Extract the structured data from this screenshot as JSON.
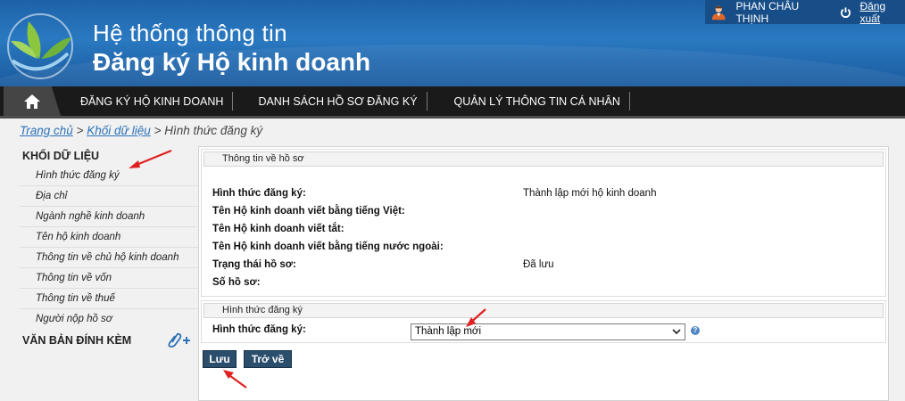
{
  "header": {
    "title_line1": "Hệ thống thông tin",
    "title_line2": "Đăng ký Hộ kinh doanh",
    "user_name": "PHAN CHÂU THỊNH",
    "logout_label": "Đăng xuất",
    "colors": {
      "banner": "#2a79c1",
      "nav": "#1a1a1a"
    }
  },
  "nav": {
    "home_icon": "home-icon",
    "items": [
      "ĐĂNG KÝ HỘ KINH DOANH",
      "DANH SÁCH HỒ SƠ ĐĂNG KÝ",
      "QUẢN LÝ THÔNG TIN CÁ NHÂN"
    ]
  },
  "breadcrumb": {
    "home": "Trang chủ",
    "separator": ">",
    "section": "Khối dữ liệu",
    "current": "Hình thức đăng ký"
  },
  "sidebar": {
    "heading": "KHỐI DỮ LIỆU",
    "items": [
      "Hình thức đăng ký",
      "Địa chỉ",
      "Ngành nghề kinh doanh",
      "Tên hộ kinh doanh",
      "Thông tin về chủ hộ kinh doanh",
      "Thông tin về vốn",
      "Thông tin về thuế",
      "Người nộp hồ sơ"
    ],
    "attachments_heading": "VĂN BẢN ĐÍNH KÈM"
  },
  "info": {
    "title": "Thông tin về hồ sơ",
    "rows": [
      {
        "label": "Hình thức đăng ký:",
        "value": "Thành lập mới hộ kinh doanh"
      },
      {
        "label": "Tên Hộ kinh doanh viết bằng tiếng Việt:",
        "value": ""
      },
      {
        "label": "Tên Hộ kinh doanh viết tắt:",
        "value": ""
      },
      {
        "label": "Tên Hộ kinh doanh viết bằng tiếng nước ngoài:",
        "value": ""
      },
      {
        "label": "Trạng thái hồ sơ:",
        "value": "Đã lưu"
      },
      {
        "label": "Số hồ sơ:",
        "value": ""
      }
    ]
  },
  "form": {
    "title": "Hình thức đăng ký",
    "label": "Hình thức đăng ký:",
    "selected": "Thành lập mới",
    "help": "?"
  },
  "buttons": {
    "save": "Lưu",
    "back": "Trở về"
  }
}
